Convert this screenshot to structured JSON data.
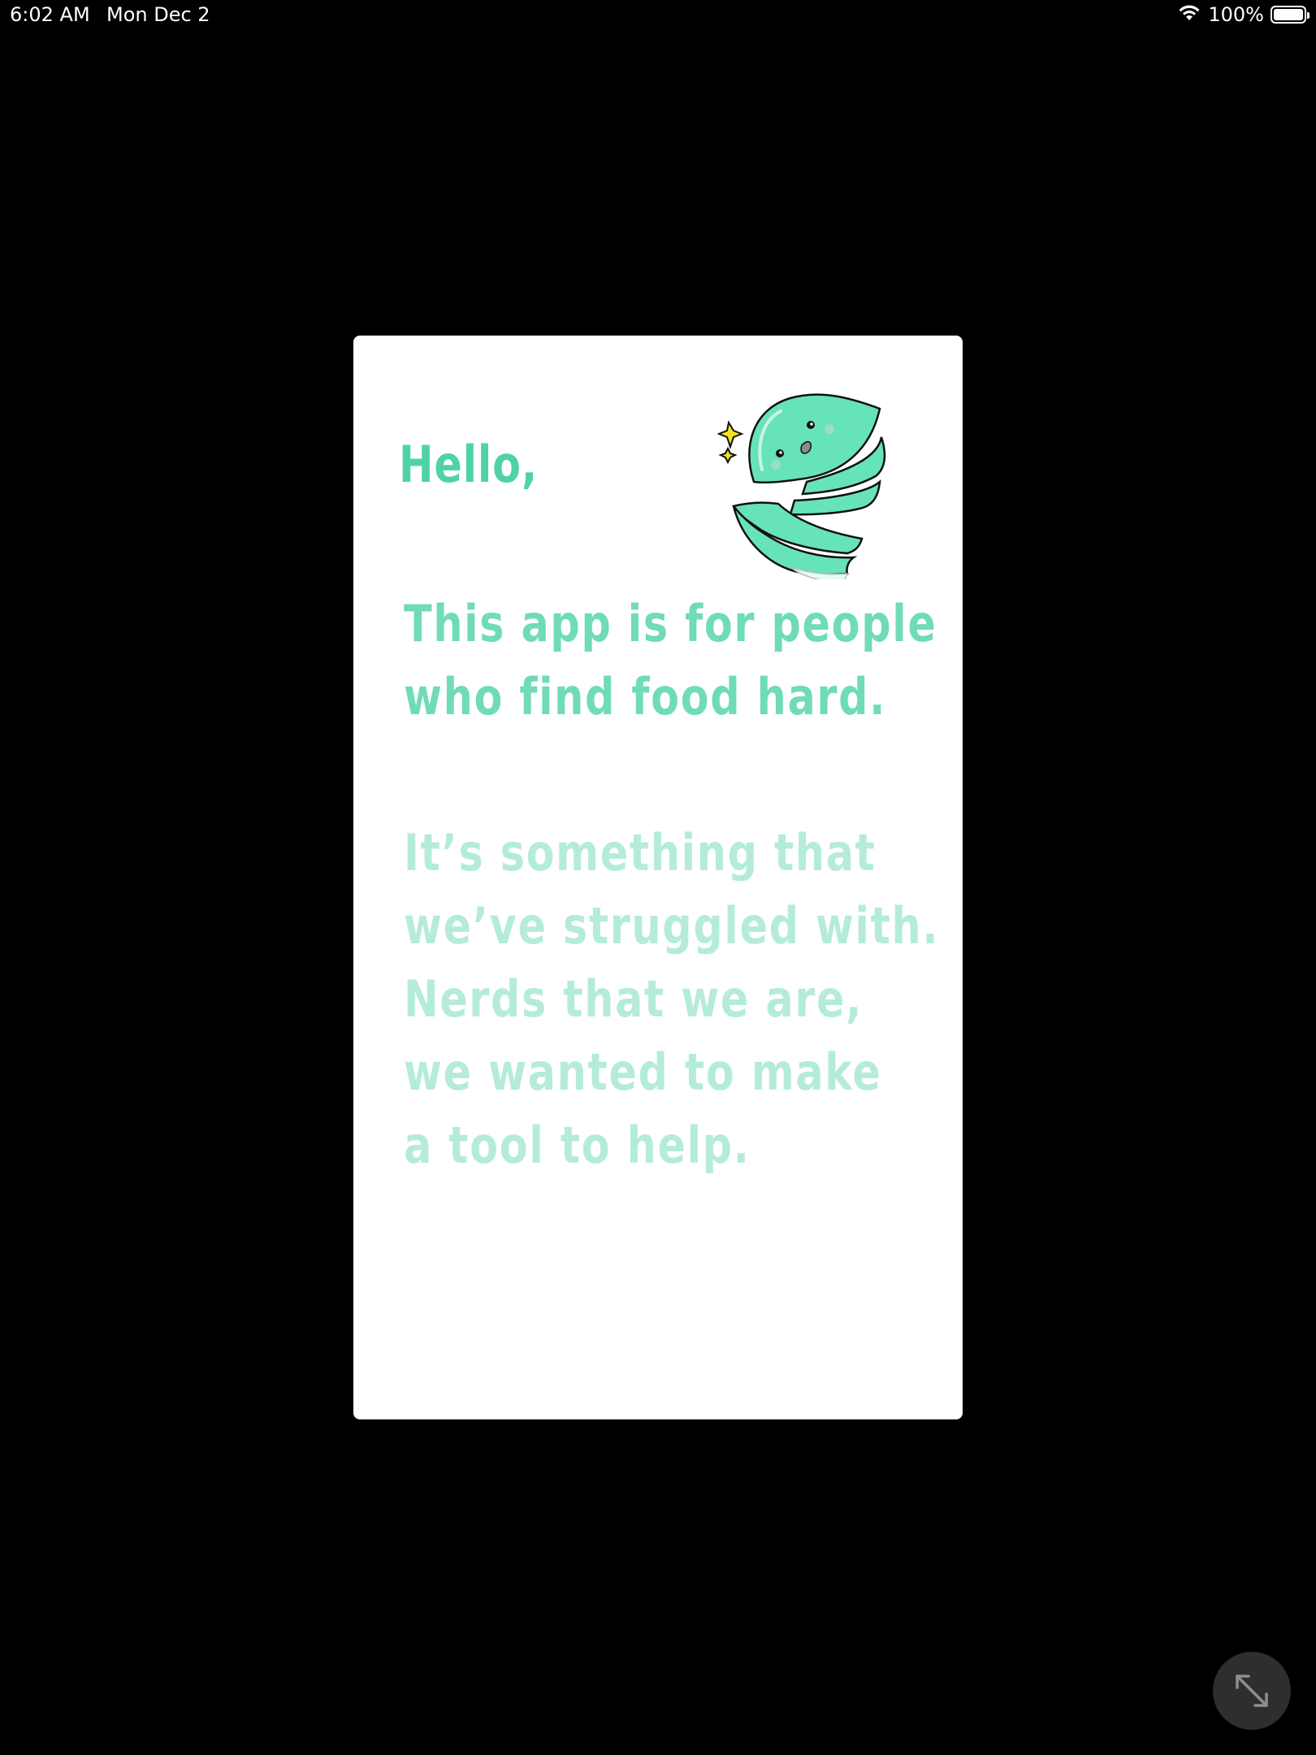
{
  "status_bar": {
    "time": "6:02 AM",
    "date": "Mon Dec 2",
    "battery_percent": "100%",
    "wifi_icon": "wifi-icon",
    "battery_icon": "battery-icon"
  },
  "card": {
    "greeting": "Hello,",
    "intro_lines": [
      "This app is for people",
      "who find food hard."
    ],
    "story_lines": [
      "It’s something that",
      "we’ve struggled with.",
      "Nerds that we are,",
      "we wanted to make",
      "a tool to help."
    ],
    "mascot_icon": "mascot-illustration"
  },
  "controls": {
    "expand_icon": "expand-arrows-icon"
  },
  "colors": {
    "background": "#000000",
    "card": "#ffffff",
    "greeting": "#4fd3a5",
    "intro_text": "#6fdcb5",
    "story_text": "#b5ecd8",
    "mascot_green": "#66e3b9",
    "sparkle": "#f4e21a",
    "expand_button": "#2e2e2e"
  }
}
